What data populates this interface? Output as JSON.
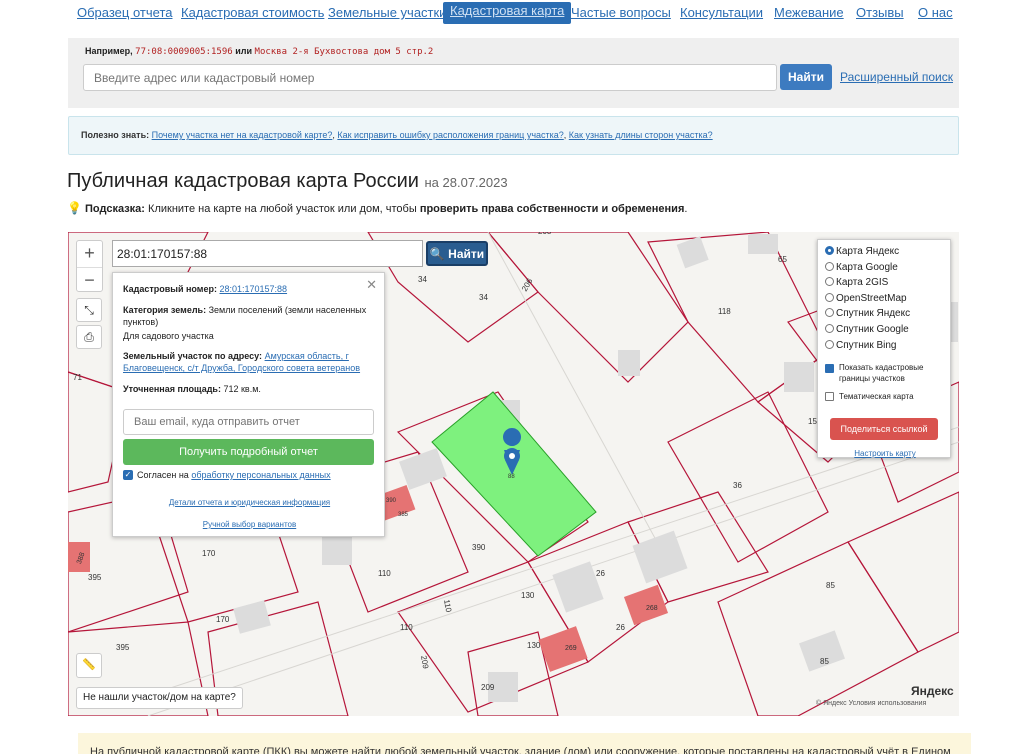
{
  "nav": {
    "items": [
      "Образец отчета",
      "Кадастровая стоимость",
      "Земельные участки",
      "Кадастровая карта",
      "Частые вопросы",
      "Консультации",
      "Межевание",
      "Отзывы",
      "О нас"
    ]
  },
  "search": {
    "example_prefix": "Например,",
    "example_code": "77:08:0009005:1596",
    "example_or": "или",
    "example_addr": "Москва 2-я Бухвостова дом 5 стр.2",
    "placeholder": "Введите адрес или кадастровый номер",
    "button": "Найти",
    "advanced": "Расширенный поиск"
  },
  "useful": {
    "label": "Полезно знать:",
    "links": [
      "Почему участка нет на кадастровой карте?",
      "Как исправить ошибку расположения границ участка?",
      "Как узнать длины сторон участка?"
    ]
  },
  "title": {
    "main": "Публичная кадастровая карта России",
    "date": "на 28.07.2023"
  },
  "hint": {
    "label": "Подсказка:",
    "text": "Кликните на карте на любой участок или дом, чтобы",
    "bold": "проверить права собственности и обременения",
    "end": "."
  },
  "map": {
    "search_value": "28:01:170157:88",
    "search_button": "Найти",
    "popup": {
      "cadastral_label": "Кадастровый номер:",
      "cadastral_value": "28:01:170157:88",
      "category_label": "Категория земель:",
      "category_value": "Земли поселений (земли населенных пунктов)",
      "use_value": "Для садового участка",
      "address_label": "Земельный участок по адресу:",
      "address_value": "Амурская область, г Благовещенск, с/т Дружба, Городского совета ветеранов",
      "area_label": "Уточненная площадь:",
      "area_value": "712 кв.м.",
      "email_placeholder": "Ваш email, куда отправить отчет",
      "report_button": "Получить подробный отчет",
      "consent_text": "Согласен на",
      "consent_link": "обработку персональных данных",
      "details_link": "Детали отчета и юридическая информация",
      "manual_link": "Ручной выбор вариантов"
    },
    "layers": {
      "options": [
        "Карта Яндекс",
        "Карта Google",
        "Карта 2GIS",
        "OpenStreetMap",
        "Спутник Яндекс",
        "Спутник Google",
        "Спутник Bing"
      ],
      "selected": "Карта Яндекс",
      "show_borders": "Показать кадастровые границы участков",
      "thematic": "Тематическая карта",
      "share_button": "Поделиться ссылкой",
      "configure": "Настроить карту"
    },
    "not_found": "Не нашли участок/дом на карте?",
    "logo": "Яндекс",
    "copyright": "© Яндекс  Условия использования",
    "labels": [
      "208",
      "34",
      "34",
      "206",
      "65",
      "118",
      "71",
      "15",
      "88",
      "36",
      "390",
      "395",
      "170",
      "170",
      "110",
      "110",
      "110",
      "130",
      "130",
      "26",
      "26",
      "268",
      "269",
      "209",
      "209",
      "395",
      "85",
      "85",
      "390",
      "385",
      "388"
    ]
  },
  "footer": {
    "text": "На публичной кадастровой карте (ПКК) вы можете найти любой земельный участок, здание (дом) или сооружение, которые поставлены на кадастровый учёт в Едином"
  },
  "colors": {
    "link": "#2a6db3",
    "parcel_highlight": "#7ef17e",
    "parcel_border": "#b5163a",
    "building_red": "#e57373"
  }
}
